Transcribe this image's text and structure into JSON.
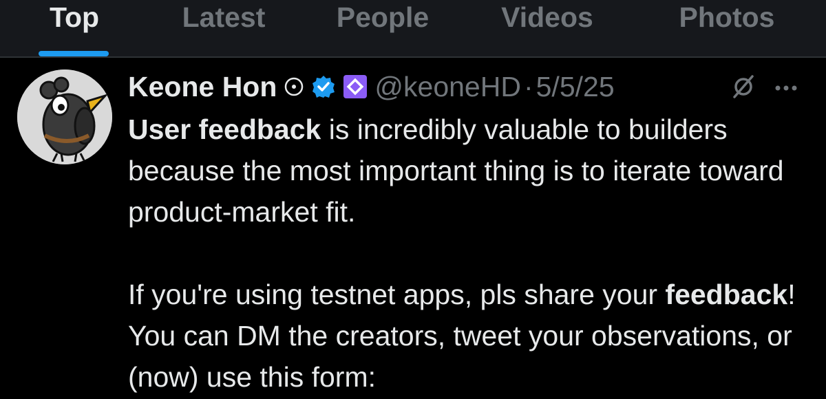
{
  "tabs": [
    {
      "label": "Top",
      "active": true
    },
    {
      "label": "Latest",
      "active": false
    },
    {
      "label": "People",
      "active": false
    },
    {
      "label": "Videos",
      "active": false
    },
    {
      "label": "Photos",
      "active": false
    }
  ],
  "tweet": {
    "author": {
      "display_name": "Keone Hon",
      "handle": "@keoneHD",
      "verified": true
    },
    "separator": "·",
    "date": "5/5/25",
    "paragraph1": {
      "bold": "User feedback",
      "rest": " is incredibly valuable to builders because the most important thing is to iterate toward product-market fit."
    },
    "paragraph2": {
      "lead": "If you're using testnet apps, pls share your ",
      "bold": "feedback",
      "rest": "! You can DM the creators, tweet your observations, or (now) use this form:"
    }
  },
  "icons": {
    "status": "circle-dot-icon",
    "verified": "verified-badge-icon",
    "affiliate": "affiliate-badge-icon",
    "grok": "grok-icon",
    "more": "more-icon"
  },
  "colors": {
    "accent": "#1d9bf0",
    "affiliate": "#8b5cf6",
    "text": "#e7e9ea",
    "muted": "#71767b"
  }
}
